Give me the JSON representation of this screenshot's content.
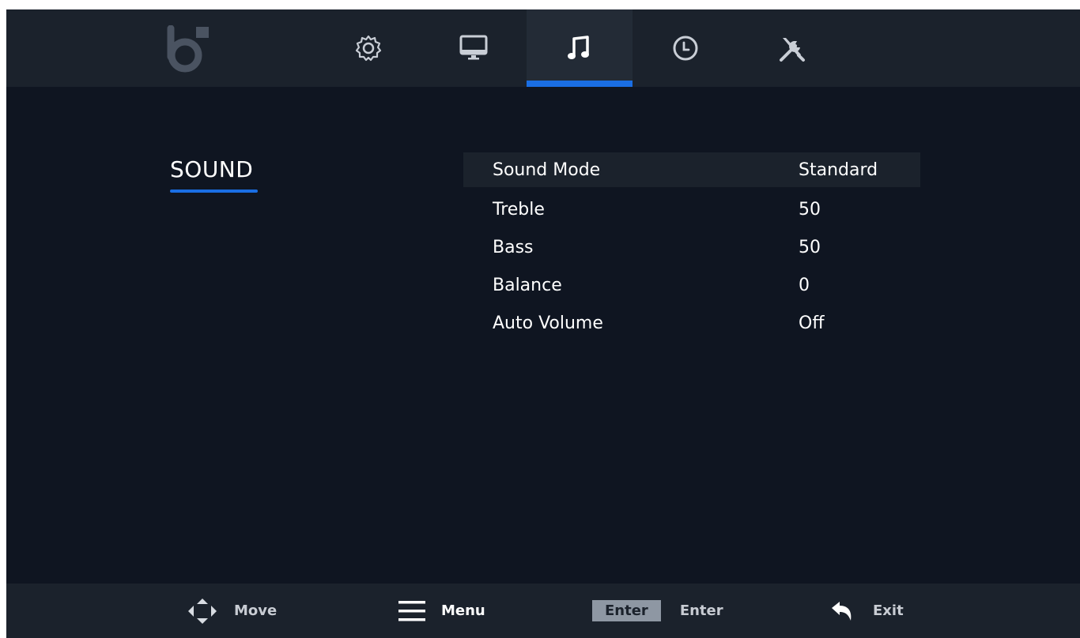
{
  "topbar": {
    "tabs": [
      {
        "icon": "gear-icon",
        "active": false
      },
      {
        "icon": "monitor-icon",
        "active": false
      },
      {
        "icon": "music-note-icon",
        "active": true
      },
      {
        "icon": "clock-icon",
        "active": false
      },
      {
        "icon": "tools-icon",
        "active": false
      }
    ],
    "logo_icon": "brand-logo-icon",
    "accent_color": "#1a6ee4"
  },
  "section": {
    "title": "SOUND"
  },
  "settings": [
    {
      "label": "Sound Mode",
      "value": "Standard",
      "selected": true
    },
    {
      "label": "Treble",
      "value": "50",
      "selected": false
    },
    {
      "label": "Bass",
      "value": "50",
      "selected": false
    },
    {
      "label": "Balance",
      "value": "0",
      "selected": false
    },
    {
      "label": "Auto Volume",
      "value": "Off",
      "selected": false
    }
  ],
  "hints": {
    "move": "Move",
    "menu": "Menu",
    "enter_key": "Enter",
    "enter": "Enter",
    "exit": "Exit"
  }
}
